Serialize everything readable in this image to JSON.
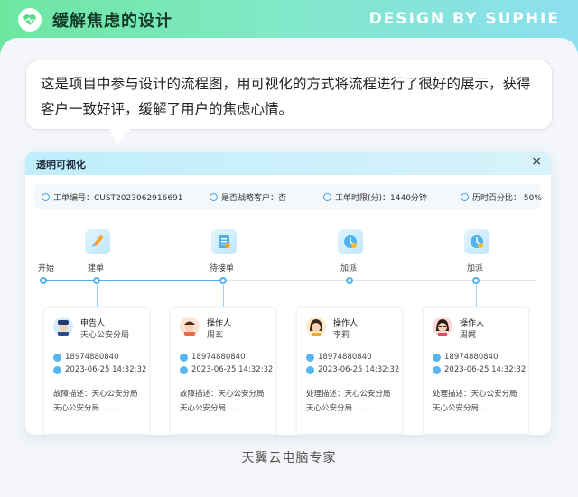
{
  "banner": {
    "title": "缓解焦虑的设计",
    "brand": "DESIGN BY SUPHIE"
  },
  "bubble": {
    "text": "这是项目中参与设计的流程图，用可视化的方式将流程进行了很好的展示，获得客户一致好评，缓解了用户的焦虑心情。"
  },
  "dialog": {
    "title": "透明可视化",
    "close": "×",
    "info": [
      {
        "label": "工单编号：CUST2023062916691",
        "icon": "ticket-icon"
      },
      {
        "label": "是否战略客户：否",
        "icon": "user-icon"
      },
      {
        "label": "工单时限(分)：1440分钟",
        "icon": "clock-icon"
      },
      {
        "label": "历时百分比：  50%",
        "icon": "percent-icon"
      }
    ],
    "start_label": "开始",
    "progress_fraction": 0.37,
    "stages": [
      {
        "label": "建单",
        "icon": "pen-icon"
      },
      {
        "label": "待接单",
        "icon": "list-icon"
      },
      {
        "label": "加派",
        "icon": "clock-badge-icon"
      },
      {
        "label": "加派",
        "icon": "clock-badge-icon"
      }
    ],
    "cards": [
      {
        "role": "申告人",
        "name": "天心公安分局",
        "phone": "18974880840",
        "time": "2023-06-25 14:32:32",
        "desc": "故障描述：天心公安分局天心公安分局..........",
        "avatar": "police-avatar"
      },
      {
        "role": "操作人",
        "name": "周玄",
        "phone": "18974880840",
        "time": "2023-06-25 14:32:32",
        "desc": "故障描述：天心公安分局天心公安分局..........",
        "avatar": "man-avatar"
      },
      {
        "role": "操作人",
        "name": "李莉",
        "phone": "18974880840",
        "time": "2023-06-25 14:32:32",
        "desc": "处理描述：天心公安分局天心公安分局..........",
        "avatar": "woman-avatar"
      },
      {
        "role": "操作人",
        "name": "周娓",
        "phone": "18974880840",
        "time": "2023-06-25 14:32:32",
        "desc": "处理描述：天心公安分局天心公安分局..........",
        "avatar": "woman2-avatar"
      }
    ]
  },
  "footer": {
    "text": "天翼云电脑专家"
  },
  "colors": {
    "accent": "#4fb2ef",
    "banner_start": "#6ee6a0",
    "banner_end": "#8ddff0"
  }
}
